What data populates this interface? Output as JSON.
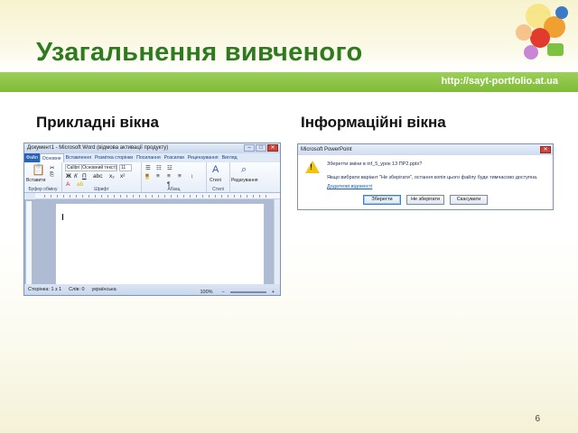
{
  "slide": {
    "title": "Узагальнення вивченого",
    "url": "http://sayt-portfolio.at.ua",
    "left_heading": "Прикладні вікна",
    "right_heading": "Інформаційні вікна",
    "page_number": "6"
  },
  "colors": {
    "title": "#2e7a1f",
    "bar": "#8cc63f",
    "url": "#ffffff"
  },
  "word_window": {
    "title": "Документ1 - Microsoft Word (відмова активації продукту)",
    "tabs": [
      "Файл",
      "Основне",
      "Вставлення",
      "Розмітка сторінки",
      "Посилання",
      "Розсилки",
      "Рецензування",
      "Вигляд"
    ],
    "font_name": "Calibri (Основний текст)",
    "font_size": "11",
    "paste_label": "Вставити",
    "styles_label": "Стилі",
    "editing_label": "Редагування",
    "group_clipboard": "Буфер обміну",
    "group_font": "Шрифт",
    "group_paragraph": "Абзац",
    "group_styles": "Стилі",
    "status_page": "Сторінка: 1 з 1",
    "status_words": "Слів: 0",
    "status_lang": "українська",
    "zoom": "100%"
  },
  "message_box": {
    "title": "Microsoft PowerPoint",
    "line1": "Зберегти зміни в inf_5_урок 13 ПР2.pptx?",
    "line2": "Якщо вибрати варіант \"Не зберігати\", остання копія цього файлу буде тимчасово доступна.",
    "link": "Додаткові відомості",
    "buttons": [
      "Зберегти",
      "Не зберігати",
      "Скасувати"
    ]
  }
}
